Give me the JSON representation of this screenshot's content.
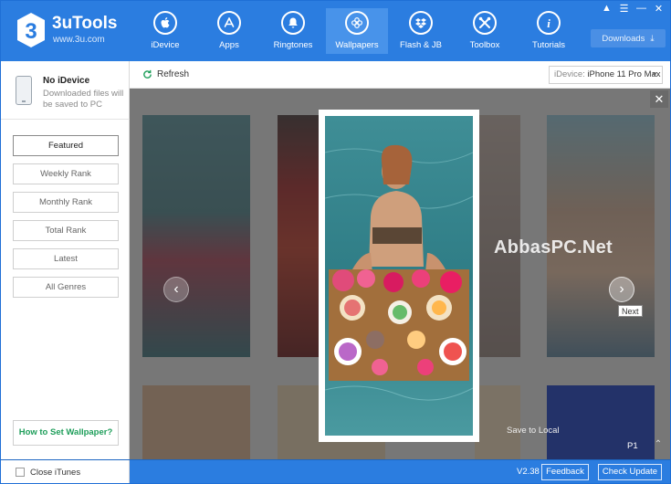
{
  "app": {
    "name": "3uTools",
    "site": "www.3u.com",
    "logo_digit": "3"
  },
  "window_controls": [
    "shirt-icon",
    "menu-icon",
    "minimize-icon",
    "close-icon"
  ],
  "nav": [
    {
      "label": "iDevice",
      "icon": "apple-icon"
    },
    {
      "label": "Apps",
      "icon": "app-store-icon"
    },
    {
      "label": "Ringtones",
      "icon": "bell-icon"
    },
    {
      "label": "Wallpapers",
      "icon": "flower-icon",
      "active": true
    },
    {
      "label": "Flash & JB",
      "icon": "dropbox-icon"
    },
    {
      "label": "Toolbox",
      "icon": "tools-icon"
    },
    {
      "label": "Tutorials",
      "icon": "info-icon"
    }
  ],
  "downloads_label": "Downloads",
  "device": {
    "title": "No iDevice",
    "subtitle": "Downloaded files will be saved to PC"
  },
  "menu": [
    {
      "label": "Featured",
      "active": true
    },
    {
      "label": "Weekly Rank"
    },
    {
      "label": "Monthly Rank"
    },
    {
      "label": "Total Rank"
    },
    {
      "label": "Latest"
    },
    {
      "label": "All Genres"
    }
  ],
  "how_to_label": "How to Set Wallpaper?",
  "toolbar": {
    "refresh_label": "Refresh",
    "idevice_prefix": "iDevice:",
    "idevice_value": "iPhone 11 Pro Max"
  },
  "viewer": {
    "watermark": "AbbasPC.Net",
    "next_tooltip": "Next",
    "save_label": "Save to Local",
    "page_label": "P1"
  },
  "status": {
    "close_itunes_label": "Close iTunes",
    "version": "V2.38",
    "feedback_label": "Feedback",
    "check_update_label": "Check Update"
  },
  "colors": {
    "brand": "#2b7de0",
    "accent_green": "#1e9e5a"
  }
}
